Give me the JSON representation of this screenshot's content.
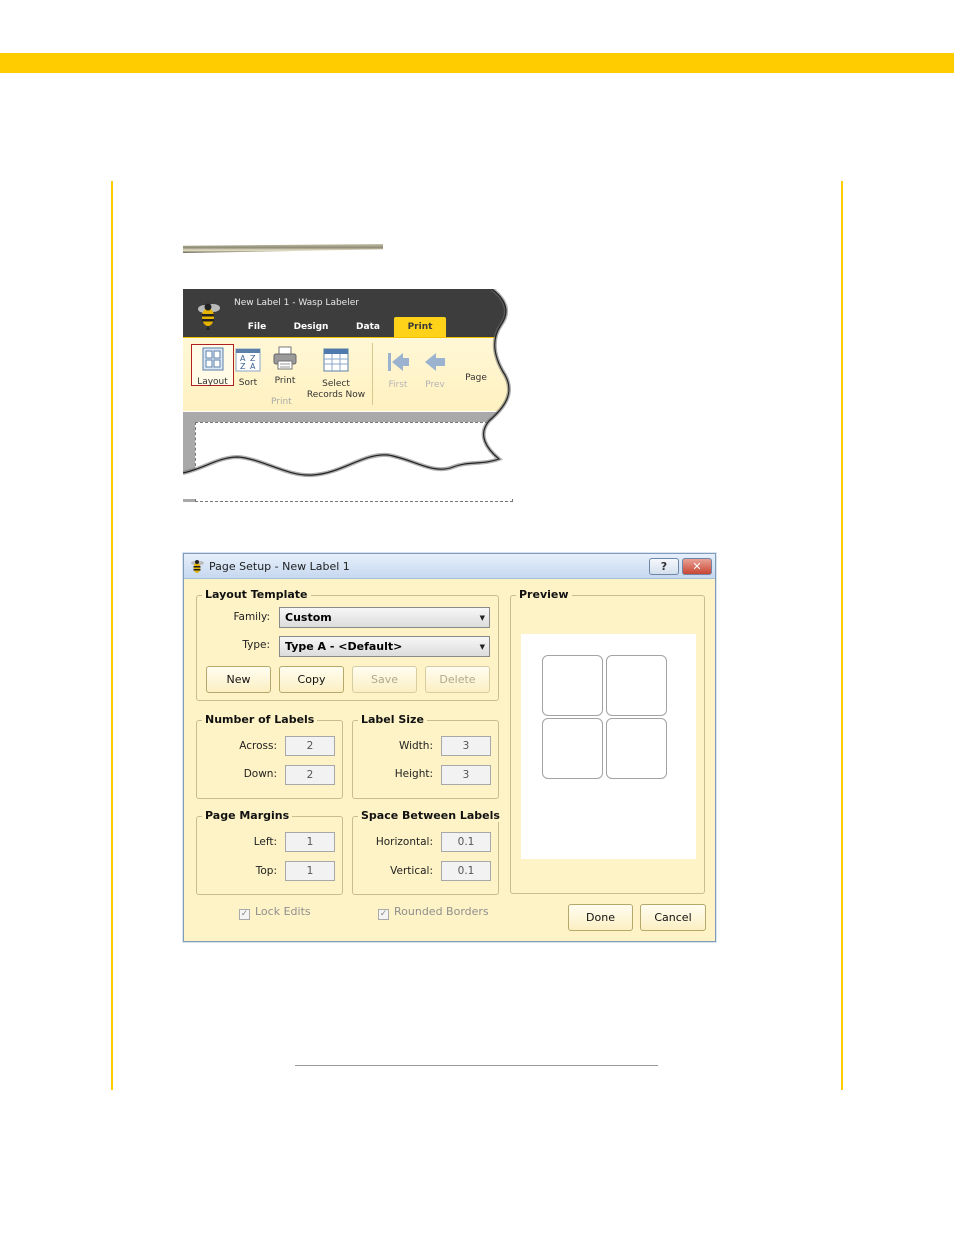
{
  "ribbon": {
    "window_title": "New Label 1 - Wasp Labeler",
    "tabs": [
      {
        "label": "File"
      },
      {
        "label": "Design"
      },
      {
        "label": "Data"
      },
      {
        "label": "Print"
      }
    ],
    "buttons": {
      "layout": "Layout",
      "sort": "Sort",
      "print": "Print",
      "select_records_line1": "Select",
      "select_records_line2": "Records Now",
      "first": "First",
      "prev": "Prev",
      "page": "Page"
    },
    "group_label": "Print"
  },
  "dialog": {
    "title": "Page Setup - New Label 1",
    "help_label": "?",
    "close_label": "✕",
    "layout_template": {
      "legend": "Layout Template",
      "family_label": "Family:",
      "family_value": "Custom",
      "type_label": "Type:",
      "type_value": "Type A - <Default>",
      "buttons": {
        "new": "New",
        "copy": "Copy",
        "save": "Save",
        "delete": "Delete"
      }
    },
    "number_of_labels": {
      "legend": "Number of Labels",
      "across_label": "Across:",
      "across_value": "2",
      "down_label": "Down:",
      "down_value": "2"
    },
    "label_size": {
      "legend": "Label Size",
      "width_label": "Width:",
      "width_value": "3",
      "height_label": "Height:",
      "height_value": "3"
    },
    "page_margins": {
      "legend": "Page Margins",
      "left_label": "Left:",
      "left_value": "1",
      "top_label": "Top:",
      "top_value": "1"
    },
    "space_between": {
      "legend": "Space Between Labels",
      "horizontal_label": "Horizontal:",
      "horizontal_value": "0.1",
      "vertical_label": "Vertical:",
      "vertical_value": "0.1"
    },
    "preview": {
      "legend": "Preview",
      "across": 2,
      "down": 2
    },
    "checks": {
      "lock_edits": "Lock Edits",
      "rounded_borders": "Rounded Borders",
      "check_mark": "✓"
    },
    "done_label": "Done",
    "cancel_label": "Cancel"
  },
  "colors": {
    "accent": "#ffcc00",
    "print_tab": "#ffd21a",
    "dialog_bg": "#fdf3c6"
  }
}
